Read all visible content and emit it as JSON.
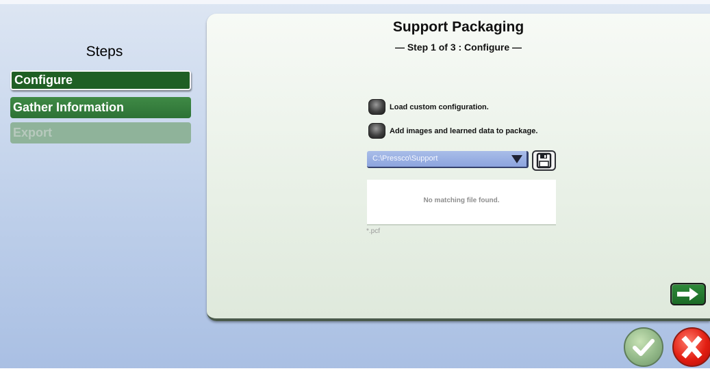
{
  "steps_panel": {
    "title": "Steps",
    "items": [
      {
        "label": "Configure",
        "state": "active"
      },
      {
        "label": "Gather Information",
        "state": "normal"
      },
      {
        "label": "Export",
        "state": "disabled"
      }
    ]
  },
  "header": {
    "title": "Support Packaging",
    "subtitle": "— Step 1 of 3 : Configure —"
  },
  "options": {
    "load_custom_label": "Load custom configuration.",
    "add_images_label": "Add images and learned data to package."
  },
  "folder": {
    "path": "C:\\Pressco\\Support",
    "save_icon": "floppy-disk-icon"
  },
  "file_list": {
    "empty_message": "No matching file found.",
    "filter": "*.pcf"
  },
  "actions": {
    "next_icon": "arrow-right-icon",
    "ok_icon": "checkmark-icon",
    "cancel_icon": "x-icon"
  },
  "colors": {
    "step_active": "#1f5f24",
    "step_normal": "#3f8a46",
    "step_disabled": "#8fb39a",
    "ok_green": "#92b888",
    "cancel_red": "#e21e12"
  }
}
